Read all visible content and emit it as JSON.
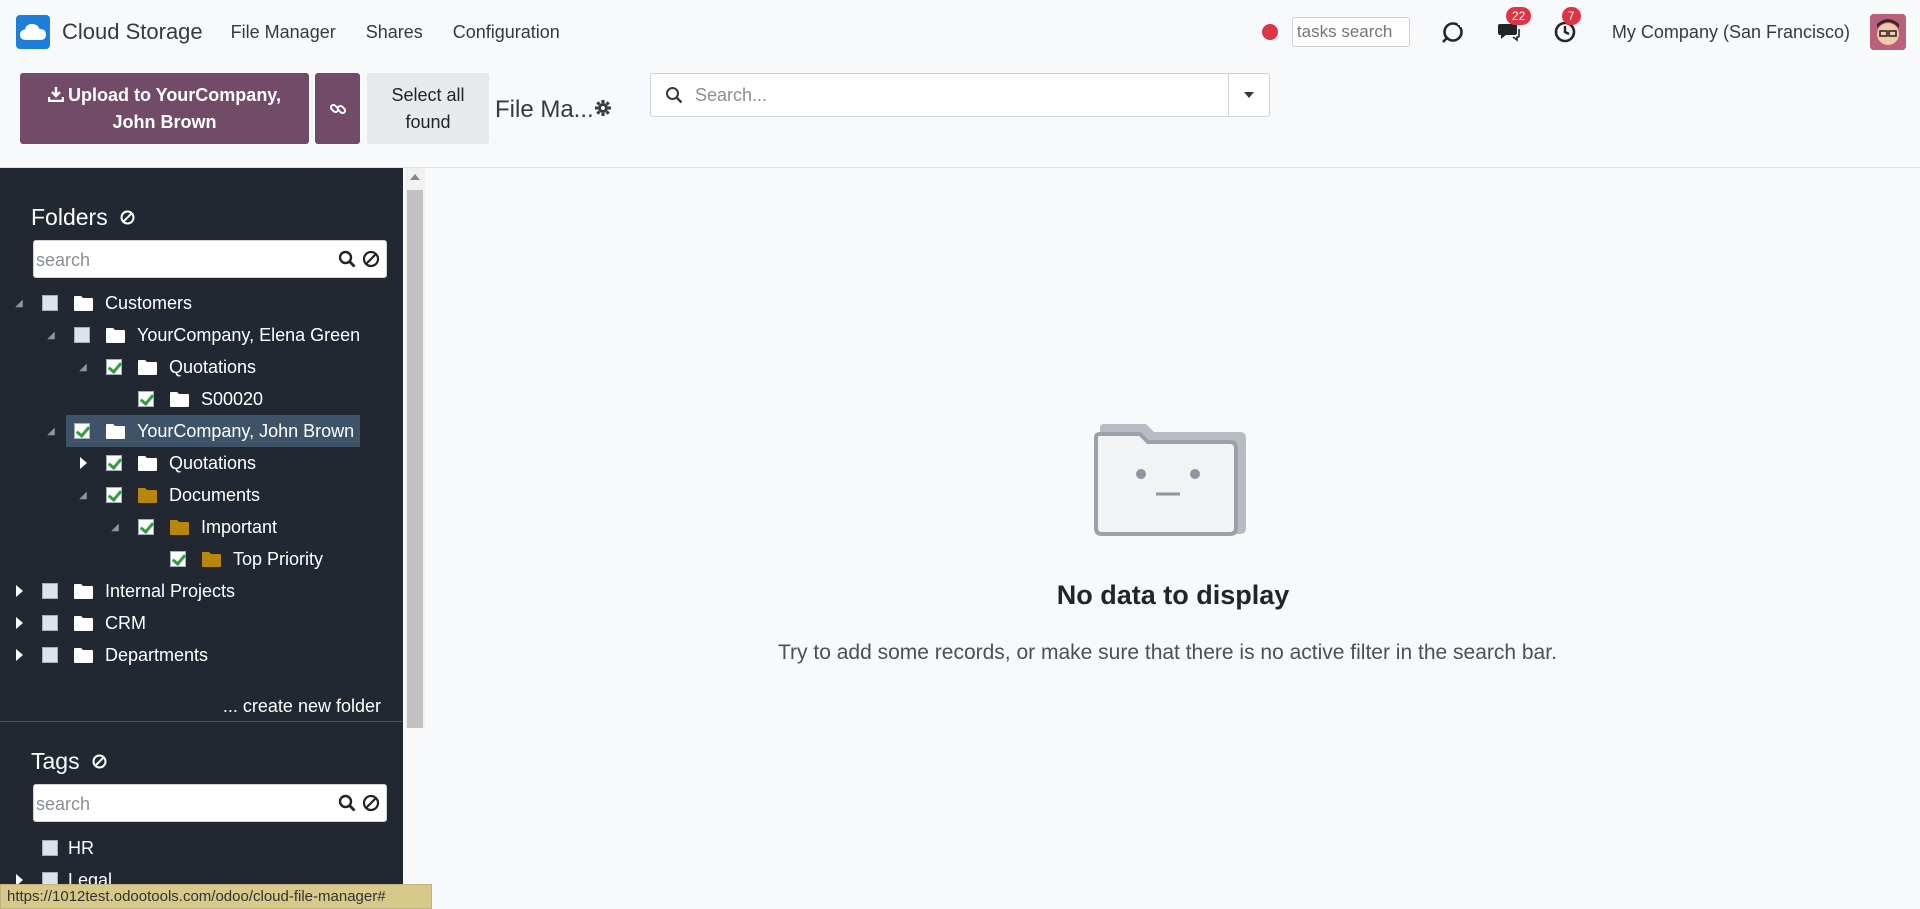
{
  "navbar": {
    "app_name": "Cloud Storage",
    "menu": [
      "File Manager",
      "Shares",
      "Configuration"
    ],
    "tasks_search_placeholder": "tasks search",
    "messages_count": "22",
    "activities_count": "7",
    "company": "My Company (San Francisco)"
  },
  "control": {
    "upload_label": "Upload to YourCompany, John Brown",
    "select_all_label": "Select all found",
    "view_title": "File Ma...",
    "search_placeholder": "Search..."
  },
  "sidebar": {
    "folders_title": "Folders",
    "folders_search_placeholder": "search",
    "folders": [
      {
        "label": "Customers"
      },
      {
        "label": "YourCompany, Elena Green"
      },
      {
        "label": "Quotations"
      },
      {
        "label": "S00020"
      },
      {
        "label": "YourCompany, John Brown"
      },
      {
        "label": "Quotations"
      },
      {
        "label": "Documents"
      },
      {
        "label": "Important"
      },
      {
        "label": "Top Priority"
      },
      {
        "label": "Internal Projects"
      },
      {
        "label": "CRM"
      },
      {
        "label": "Departments"
      }
    ],
    "create_folder_label": "... create new folder",
    "tags_title": "Tags",
    "tags_search_placeholder": "search",
    "tags": [
      {
        "label": "HR"
      },
      {
        "label": "Legal"
      }
    ]
  },
  "empty_state": {
    "title": "No data to display",
    "subtitle": "Try to add some records, or make sure that there is no active filter in the search bar."
  },
  "statusbar": {
    "url": "https://1012test.odootools.com/odoo/cloud-file-manager#"
  },
  "colors": {
    "primary": "#714b67",
    "sidebar_bg": "#222831",
    "selected_row": "#3e5367",
    "badge": "#dc3545",
    "folder_white": "#ffffff",
    "folder_brown": "#b8860b"
  }
}
